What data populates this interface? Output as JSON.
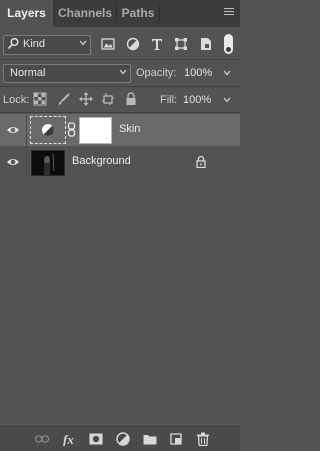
{
  "tabs": [
    {
      "label": "Layers",
      "active": true
    },
    {
      "label": "Channels",
      "active": false
    },
    {
      "label": "Paths",
      "active": false
    }
  ],
  "panel_menu_icon": "hamburger-menu-icon",
  "filter": {
    "kind_label": "Kind",
    "icons": [
      "image-filter-icon",
      "adjustment-filter-icon",
      "type-filter-icon",
      "shape-filter-icon",
      "smart-object-filter-icon"
    ],
    "toggle_on": true
  },
  "blend": {
    "mode": "Normal",
    "opacity_label": "Opacity:",
    "opacity_value": "100%"
  },
  "lock": {
    "label": "Lock:",
    "icons": [
      "lock-transparent-pixels-icon",
      "lock-image-pixels-icon",
      "lock-position-icon",
      "lock-artboard-icon",
      "lock-all-icon"
    ],
    "fill_label": "Fill:",
    "fill_value": "100%"
  },
  "layers": [
    {
      "name": "Skin",
      "selected": true,
      "visible": true,
      "type": "adjustment",
      "has_mask": true
    },
    {
      "name": "Background",
      "selected": false,
      "visible": true,
      "type": "image",
      "locked": true
    }
  ],
  "footer_icons": [
    "link-layers-icon",
    "fx-icon",
    "add-mask-icon",
    "new-adjustment-icon",
    "new-group-icon",
    "new-layer-icon",
    "delete-icon"
  ],
  "colors": {
    "panel_bg": "#535353",
    "tab_bar_bg": "#3c3c3c",
    "selected_row": "#6a6a6a"
  }
}
